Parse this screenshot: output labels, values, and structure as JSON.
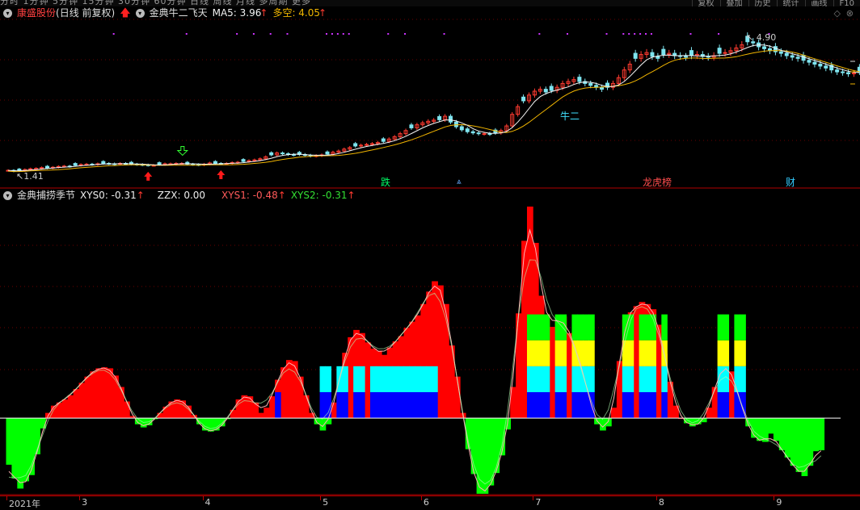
{
  "menu_bar": {
    "items": [
      "分时",
      "1分钟",
      "5分钟",
      "15分钟",
      "30分钟",
      "60分钟",
      "日线",
      "周线",
      "月线",
      "多周期",
      "更多"
    ],
    "right_tabs": [
      "复权",
      "叠加",
      "历史",
      "统计",
      "画线",
      "F10"
    ]
  },
  "main_title": {
    "stock_name": "康盛股份",
    "period": "(日线 前复权)",
    "indicator_name": "金典牛二飞天",
    "ma5": "MA5: 3.96",
    "duokong": "多空: 4.05"
  },
  "sub_title": {
    "indicator_name": "金典捕捞季节",
    "xys0": "XYS0: -0.31",
    "zzx": "ZZX: 0.00",
    "xys1": "XYS1: -0.48",
    "xys2": "XYS2: -0.31"
  },
  "price_labels": {
    "high": "4.90",
    "low": "1.41"
  },
  "annotations": {
    "niu_er": "牛二"
  },
  "events": {
    "die": "跌",
    "longhu": "龙虎榜",
    "cai": "财"
  },
  "x_axis": {
    "labels": [
      {
        "text": "2021年",
        "idx": 0
      },
      {
        "text": "3",
        "idx": 13
      },
      {
        "text": "4",
        "idx": 35
      },
      {
        "text": "5",
        "idx": 56
      },
      {
        "text": "6",
        "idx": 74
      },
      {
        "text": "7",
        "idx": 94
      },
      {
        "text": "8",
        "idx": 116
      },
      {
        "text": "9",
        "idx": 137
      }
    ]
  },
  "chart_data": [
    {
      "type": "candlestick",
      "title": "金典牛二飞天",
      "x_unit": "trading day index",
      "close": [
        1.45,
        1.43,
        1.44,
        1.47,
        1.49,
        1.5,
        1.52,
        1.51,
        1.53,
        1.55,
        1.56,
        1.55,
        1.58,
        1.6,
        1.61,
        1.6,
        1.62,
        1.63,
        1.62,
        1.61,
        1.63,
        1.62,
        1.61,
        1.6,
        1.59,
        1.58,
        1.58,
        1.6,
        1.62,
        1.62,
        1.63,
        1.63,
        1.61,
        1.6,
        1.59,
        1.61,
        1.64,
        1.63,
        1.62,
        1.63,
        1.65,
        1.66,
        1.68,
        1.7,
        1.72,
        1.75,
        1.8,
        1.85,
        1.9,
        1.88,
        1.86,
        1.85,
        1.86,
        1.84,
        1.82,
        1.83,
        1.85,
        1.87,
        1.92,
        1.95,
        2.0,
        2.04,
        2.08,
        2.1,
        2.12,
        2.14,
        2.17,
        2.2,
        2.26,
        2.32,
        2.4,
        2.48,
        2.55,
        2.63,
        2.68,
        2.72,
        2.75,
        2.76,
        2.85,
        2.7,
        2.58,
        2.5,
        2.45,
        2.42,
        2.4,
        2.4,
        2.39,
        2.42,
        2.48,
        2.6,
        2.9,
        3.1,
        3.25,
        3.4,
        3.5,
        3.55,
        3.48,
        3.52,
        3.6,
        3.7,
        3.75,
        3.8,
        3.75,
        3.7,
        3.65,
        3.6,
        3.55,
        3.6,
        3.7,
        3.85,
        4.05,
        4.2,
        4.35,
        4.45,
        4.5,
        4.4,
        4.35,
        4.45,
        4.48,
        4.42,
        4.4,
        4.38,
        4.42,
        4.45,
        4.4,
        4.38,
        4.42,
        4.48,
        4.5,
        4.55,
        4.62,
        4.7,
        4.78,
        4.75,
        4.65,
        4.6,
        4.55,
        4.52,
        4.48,
        4.42,
        4.38,
        4.35,
        4.3,
        4.25,
        4.2,
        4.15,
        4.1,
        4.05,
        4.0,
        3.98,
        3.95,
        3.97,
        4.0
      ],
      "ma5_last": 3.96,
      "duokong_last": 4.05,
      "max_price": 4.9,
      "min_price": 1.41,
      "ylim": [
        1.41,
        4.9
      ]
    },
    {
      "type": "histogram",
      "title": "金典捕捞季节",
      "ylim": [
        -0.7,
        2.04
      ],
      "values": [
        -0.45,
        -0.58,
        -0.68,
        -0.61,
        -0.55,
        -0.35,
        -0.1,
        0.05,
        0.12,
        0.15,
        0.18,
        0.22,
        0.28,
        0.34,
        0.4,
        0.45,
        0.48,
        0.49,
        0.48,
        0.41,
        0.3,
        0.16,
        0.02,
        -0.06,
        -0.09,
        -0.07,
        -0.01,
        0.05,
        0.11,
        0.16,
        0.18,
        0.17,
        0.12,
        0.03,
        -0.06,
        -0.12,
        -0.13,
        -0.12,
        -0.08,
        -0.01,
        0.08,
        0.18,
        0.22,
        0.21,
        0.15,
        0.05,
        0.1,
        0.21,
        0.37,
        0.49,
        0.56,
        0.55,
        0.4,
        0.22,
        0.05,
        -0.06,
        -0.12,
        -0.06,
        0.15,
        0.35,
        0.63,
        0.78,
        0.85,
        0.82,
        0.73,
        0.67,
        0.65,
        0.61,
        0.68,
        0.74,
        0.79,
        0.87,
        0.93,
        0.99,
        1.1,
        1.22,
        1.32,
        1.28,
        1.1,
        0.7,
        0.4,
        0.05,
        -0.3,
        -0.54,
        -0.73,
        -0.73,
        -0.65,
        -0.53,
        -0.36,
        -0.11,
        0.3,
        1.01,
        1.71,
        2.04,
        1.69,
        1.18,
        1.0,
        0.88,
        0.95,
        0.98,
        0.82,
        0.7,
        0.55,
        0.33,
        0.1,
        -0.06,
        -0.12,
        -0.08,
        0.1,
        0.55,
        0.95,
        1.02,
        1.08,
        1.12,
        1.1,
        1.05,
        0.9,
        0.62,
        0.35,
        0.12,
        0.0,
        -0.05,
        -0.08,
        -0.06,
        -0.04,
        0.1,
        0.3,
        0.44,
        0.54,
        0.45,
        0.27,
        0.08,
        -0.08,
        -0.19,
        -0.22,
        -0.23,
        -0.15,
        -0.22,
        -0.31,
        -0.38,
        -0.46,
        -0.52,
        -0.56,
        -0.46,
        -0.32,
        -0.31
      ],
      "xys0_last": -0.31,
      "zzx": 0.0,
      "xys1_last": -0.48,
      "xys2_last": -0.31
    }
  ],
  "colors": {
    "up": "#ff3b30",
    "down": "#7fe5f0",
    "ma5": "#f5f5f5",
    "duokong": "#f0b400",
    "pos_hist": "#ff0000",
    "neg_hist": "#00ff00",
    "band_blue": "#0000ff",
    "band_cyan": "#00ffff",
    "band_yellow": "#ffff00",
    "band_green": "#00ff00",
    "event_die": "#00ff66",
    "event_longhu": "#ff4d4d",
    "event_cai": "#33ccff",
    "axis_red": "#b00000"
  },
  "icons": {
    "up_arrow": "red-up-arrow-icon",
    "down_arrow": "green-hollow-down-arrow-icon",
    "dropdown": "circle-chevron-icon",
    "window_controls": "diamond-restore-icon"
  }
}
